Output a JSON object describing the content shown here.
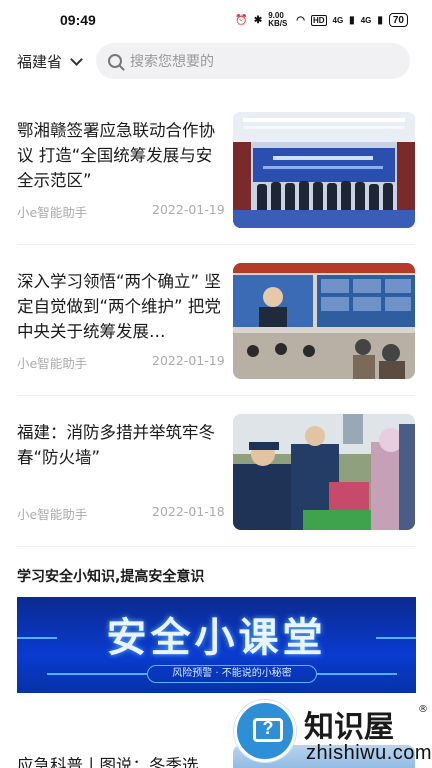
{
  "status_bar": {
    "time": "09:49",
    "network_speed": "9.00 KB/S",
    "hd_label": "HD",
    "signal_1": "4G",
    "signal_2": "4G",
    "battery": "70"
  },
  "header": {
    "region": "福建省",
    "search_placeholder": "搜索您想要的"
  },
  "articles": [
    {
      "title": "鄂湘赣签署应急联动合作协议 打造“全国统筹发展与安全示范区”",
      "source": "小e智能助手",
      "date": "2022-01-19",
      "image_alt": "签约仪式 会议照片"
    },
    {
      "title": "深入学习领悟“两个确立” 坚定自觉做到“两个维护” 把党中央关于统筹发展…",
      "source": "小e智能助手",
      "date": "2022-01-19",
      "image_alt": "视频会议 照片"
    },
    {
      "title": "福建：消防多措并举筑牢冬春“防火墙”",
      "source": "小e智能助手",
      "date": "2022-01-18",
      "image_alt": "消防宣传 照片"
    }
  ],
  "section": {
    "title": "学习安全小知识,提高安全意识",
    "banner_title": "安全小课堂",
    "banner_subtitle": "风险预警 · 不能说的小秘密"
  },
  "next_article": {
    "title": "应急科普丨图说：冬季选"
  },
  "watermark": {
    "brand": "知识屋",
    "registered": "®",
    "domain": "zhishiwu.com"
  },
  "colors": {
    "accent_blue": "#0a3bd0",
    "muted_text": "#aaaaaa",
    "search_bg": "#f1f1f3"
  }
}
